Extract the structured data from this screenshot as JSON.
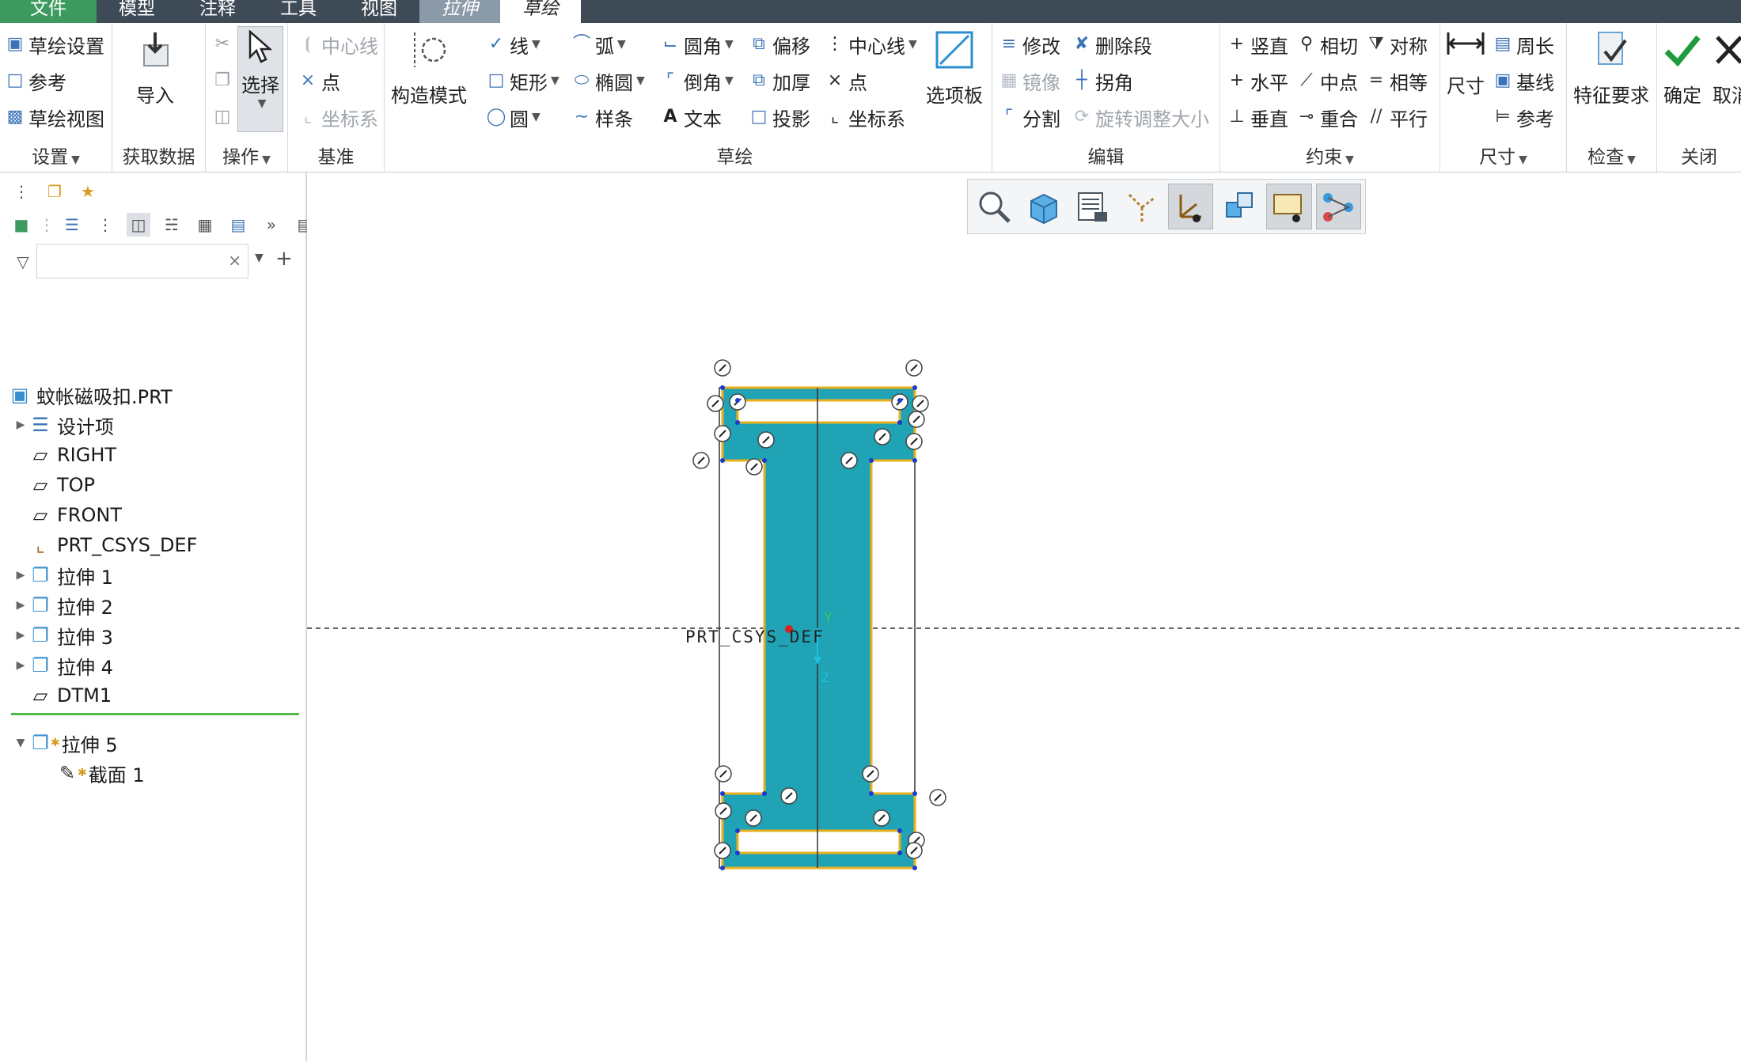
{
  "menu": {
    "tabs": [
      "文件",
      "模型",
      "注释",
      "工具",
      "视图",
      "拉伸",
      "草绘"
    ]
  },
  "ribbon": {
    "setup": {
      "items": [
        "草绘设置",
        "参考",
        "草绘视图"
      ],
      "label": "设置"
    },
    "getdata": {
      "import_label": "导入",
      "label": "获取数据"
    },
    "operations": {
      "select_label": "选择",
      "label": "操作"
    },
    "datum": {
      "items": [
        "中心线",
        "点",
        "坐标系"
      ],
      "label": "基准"
    },
    "construction": {
      "label": "构造模式"
    },
    "sketch": {
      "col1": [
        "线",
        "矩形",
        "圆"
      ],
      "col2": [
        "弧",
        "椭圆",
        "样条"
      ],
      "col3": [
        "圆角",
        "倒角",
        "文本"
      ],
      "col4": [
        "偏移",
        "加厚",
        "投影"
      ],
      "col5": [
        "中心线",
        "点",
        "坐标系"
      ],
      "palette_label": "选项板",
      "label": "草绘"
    },
    "edit": {
      "col1": [
        "修改",
        "镜像",
        "分割"
      ],
      "col2": [
        "删除段",
        "拐角",
        "旋转调整大小"
      ],
      "label": "编辑"
    },
    "constrain": {
      "col1": [
        "竖直",
        "水平",
        "垂直"
      ],
      "col2": [
        "相切",
        "中点",
        "重合"
      ],
      "col3": [
        "对称",
        "相等",
        "平行"
      ],
      "label": "约束"
    },
    "dimension": {
      "dim_label": "尺寸",
      "items": [
        "周长",
        "基线",
        "参考"
      ],
      "label": "尺寸"
    },
    "inspect": {
      "feature_req_label": "特征要求",
      "label": "检查"
    },
    "close": {
      "ok_label": "确定",
      "cancel_label": "取消",
      "label": "关闭"
    }
  },
  "tree": {
    "root": "蚊帐磁吸扣.PRT",
    "items": [
      "设计项",
      "RIGHT",
      "TOP",
      "FRONT",
      "PRT_CSYS_DEF",
      "拉伸 1",
      "拉伸 2",
      "拉伸 3",
      "拉伸 4",
      "DTM1"
    ],
    "active_feature": "拉伸 5",
    "active_child": "截面 1"
  },
  "canvas": {
    "csys_label": "PRT_CSYS_DEF",
    "axis_y": "Y",
    "axis_z": "Z",
    "sketch_fill_color": "#1fa3b5",
    "sketch_edge_color": "#e8b020"
  },
  "colors": {
    "menubar": "#3e4a56",
    "file_tab": "#3d9a5e",
    "context_tab": "#8b9aa8"
  }
}
